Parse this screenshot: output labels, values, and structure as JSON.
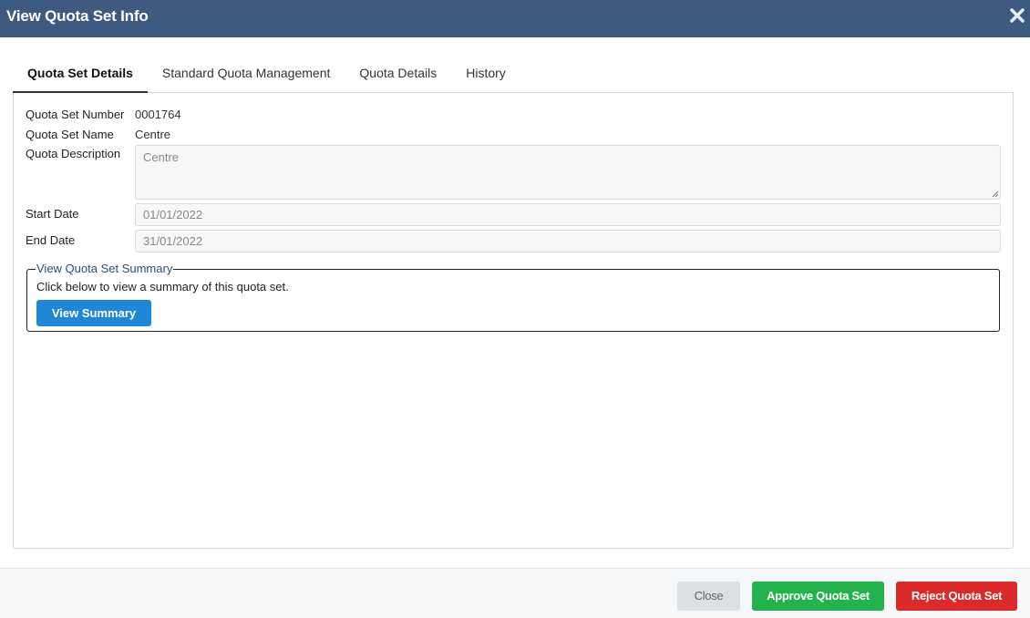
{
  "dialog": {
    "title": "View Quota Set Info",
    "close_icon": "close-icon"
  },
  "tabs": [
    {
      "label": "Quota Set Details",
      "active": true
    },
    {
      "label": "Standard Quota Management",
      "active": false
    },
    {
      "label": "Quota Details",
      "active": false
    },
    {
      "label": "History",
      "active": false
    }
  ],
  "details": {
    "number_label": "Quota Set Number",
    "number_value": "0001764",
    "name_label": "Quota Set Name",
    "name_value": "Centre",
    "description_label": "Quota Description",
    "description_value": "Centre",
    "start_label": "Start Date",
    "start_value": "01/01/2022",
    "end_label": "End Date",
    "end_value": "31/01/2022"
  },
  "summary": {
    "legend": "View Quota Set Summary",
    "description": "Click below to view a summary of this quota set.",
    "button_label": "View Summary"
  },
  "footer": {
    "close_label": "Close",
    "approve_label": "Approve Quota Set",
    "reject_label": "Reject Quota Set"
  },
  "colors": {
    "titlebar": "#3e5a80",
    "primary": "#1e87d6",
    "approve": "#23b24b",
    "reject": "#dc2a2a"
  }
}
